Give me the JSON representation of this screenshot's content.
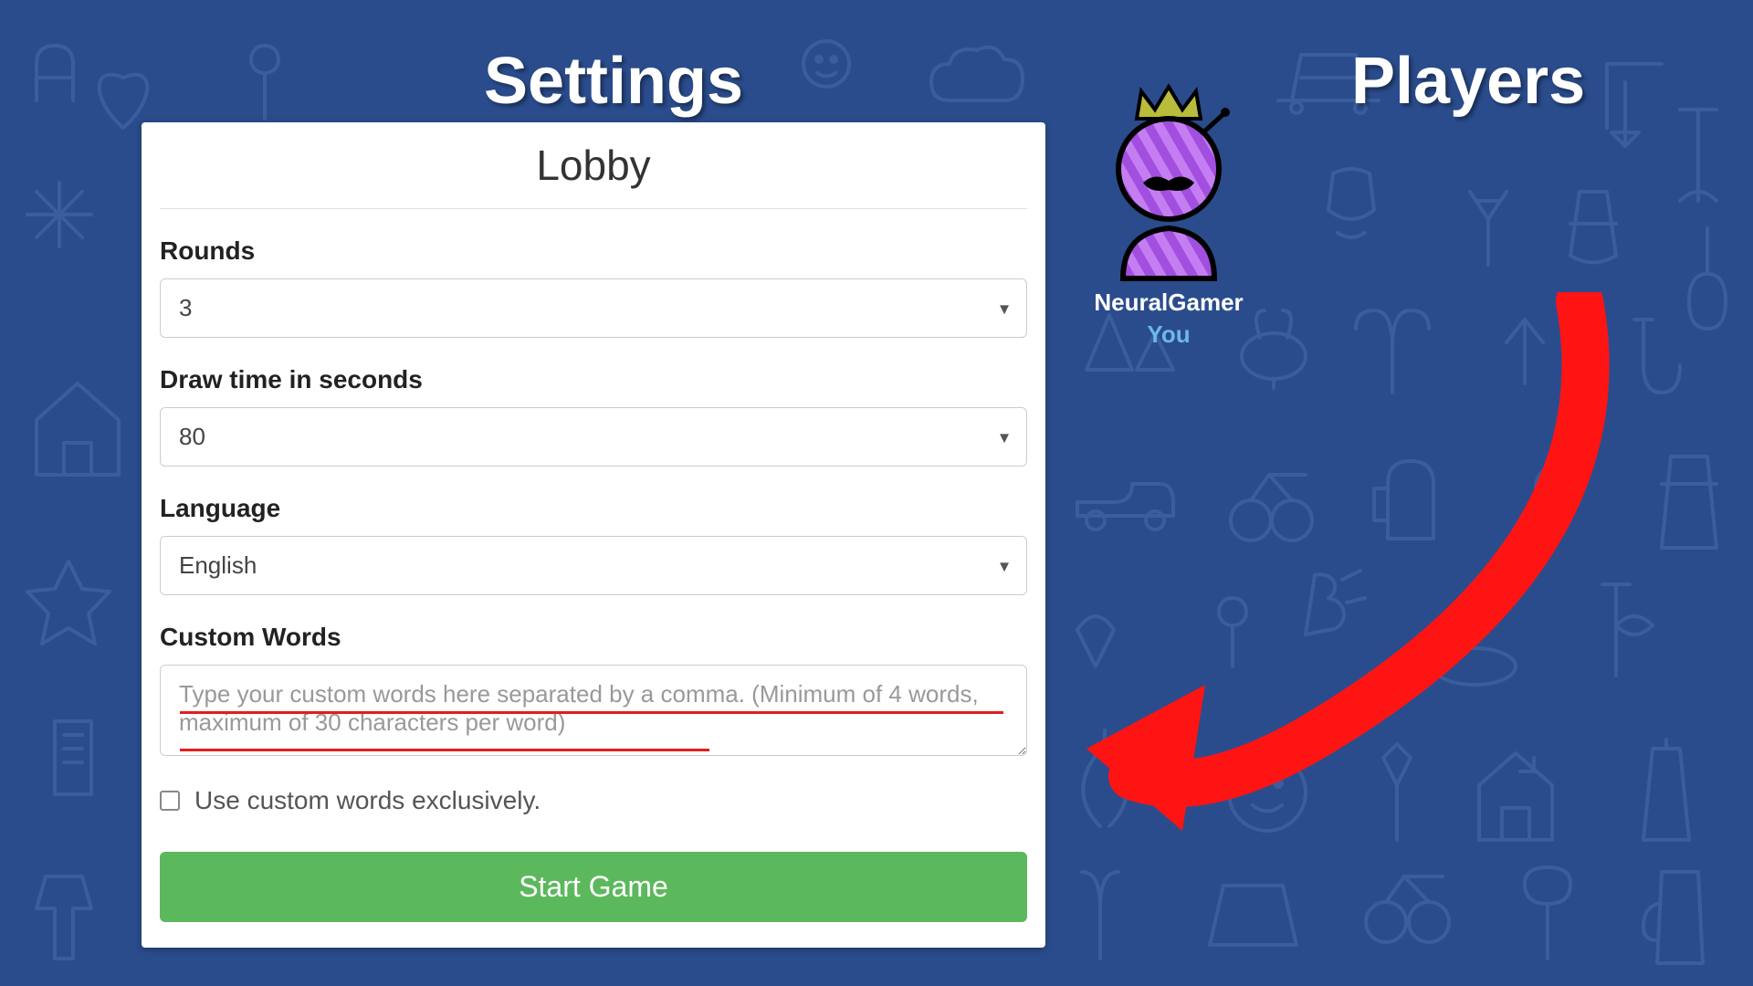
{
  "headings": {
    "settings": "Settings",
    "players": "Players"
  },
  "lobby": {
    "title": "Lobby",
    "rounds_label": "Rounds",
    "rounds_value": "3",
    "drawtime_label": "Draw time in seconds",
    "drawtime_value": "80",
    "language_label": "Language",
    "language_value": "English",
    "customwords_label": "Custom Words",
    "customwords_placeholder": "Type your custom words here separated by a comma. (Minimum of 4 words, maximum of 30 characters per word)",
    "exclusive_label": "Use custom words exclusively.",
    "start_label": "Start Game"
  },
  "player": {
    "name": "NeuralGamer",
    "you_label": "You"
  },
  "colors": {
    "accent_green": "#5cb85c",
    "bg_blue": "#2a4c8c",
    "annotation_red": "#ff0000"
  }
}
